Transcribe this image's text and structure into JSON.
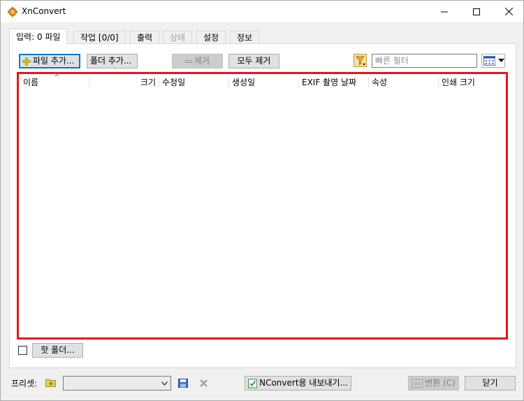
{
  "window": {
    "title": "XnConvert"
  },
  "tabs": [
    {
      "label": "입력: 0 파일",
      "state": "active"
    },
    {
      "label": "작업 [0/0]",
      "state": "normal"
    },
    {
      "label": "출력",
      "state": "normal"
    },
    {
      "label": "상태",
      "state": "disabled"
    },
    {
      "label": "설정",
      "state": "normal"
    },
    {
      "label": "정보",
      "state": "normal"
    }
  ],
  "toolbar": {
    "add_files": "파일 추가...",
    "add_folder": "폴더 추가...",
    "remove": "제거",
    "remove_all": "모두 제거",
    "filter_placeholder": "빠른 필터"
  },
  "columns": [
    "이름",
    "크기",
    "수정일",
    "생성일",
    "EXIF 촬영 날짜",
    "속성",
    "인쇄 크기"
  ],
  "hot_folder": {
    "checked": false,
    "button_label": "핫 폴더..."
  },
  "bottom": {
    "preset_label": "프리셋:",
    "preset_value": "",
    "export_nconvert": "NConvert용 내보내기...",
    "convert": "변환 (C)",
    "close": "닫기"
  },
  "colors": {
    "highlight_border": "#e8141e",
    "focus_blue": "#0078d7",
    "window_bg": "#f0f0f0"
  }
}
